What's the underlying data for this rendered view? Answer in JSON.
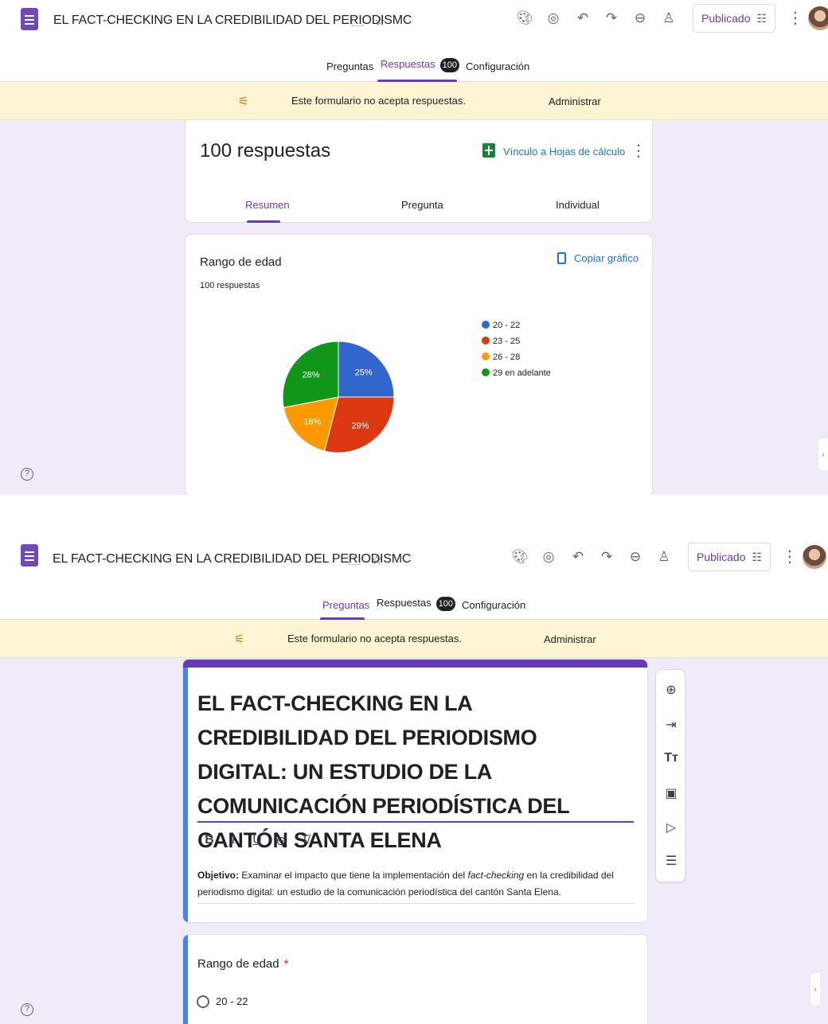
{
  "app": {
    "doc_title": "EL FACT-CHECKING EN LA CREDIBILIDAD DEL PERIODISMC",
    "publish_label": "Publicado"
  },
  "tabs": {
    "questions": "Preguntas",
    "responses": "Respuestas",
    "responses_count": "100",
    "settings": "Configuración"
  },
  "banner": {
    "message": "Este formulario no acepta respuestas.",
    "manage": "Administrar"
  },
  "responses_view": {
    "count_label": "100 respuestas",
    "sheets_link": "Vínculo a Hojas de cálculo",
    "subtabs": [
      "Resumen",
      "Pregunta",
      "Individual"
    ],
    "question_title": "Rango de edad",
    "question_sub": "100 respuestas",
    "copy_chart": "Copiar gráfico"
  },
  "chart_data": {
    "type": "pie",
    "categories": [
      "20 - 22",
      "23 - 25",
      "26 - 28",
      "29 en adelante"
    ],
    "values": [
      25,
      29,
      18,
      28
    ],
    "labels": [
      "25%",
      "29%",
      "18%",
      "28%"
    ],
    "colors": [
      "#3366cc",
      "#dc3912",
      "#ff9900",
      "#109618"
    ],
    "legend": "right"
  },
  "editor_view": {
    "form_title": "EL FACT-CHECKING EN LA CREDIBILIDAD DEL PERIODISMO DIGITAL: UN ESTUDIO DE LA COMUNICACIÓN PERIODÍSTICA DEL CANTÓN SANTA ELENA",
    "format_buttons": [
      "B",
      "I",
      "U",
      "link",
      "clear"
    ],
    "desc_label": "Objetivo:",
    "desc_part1": " Examinar el impacto que tiene la implementación del ",
    "desc_italic": "fact-checking",
    "desc_part2": " en la credibilidad del periodismo digital: un estudio de la comunicación periodística del cantón Santa Elena.",
    "question_label": "Rango de edad",
    "required_mark": "*",
    "first_option": "20 - 22"
  },
  "icons": {
    "palette": "palette-icon",
    "preview": "preview-icon",
    "undo": "undo-icon",
    "redo": "redo-icon",
    "link": "link-icon",
    "add_collab": "add-collaborator-icon"
  }
}
